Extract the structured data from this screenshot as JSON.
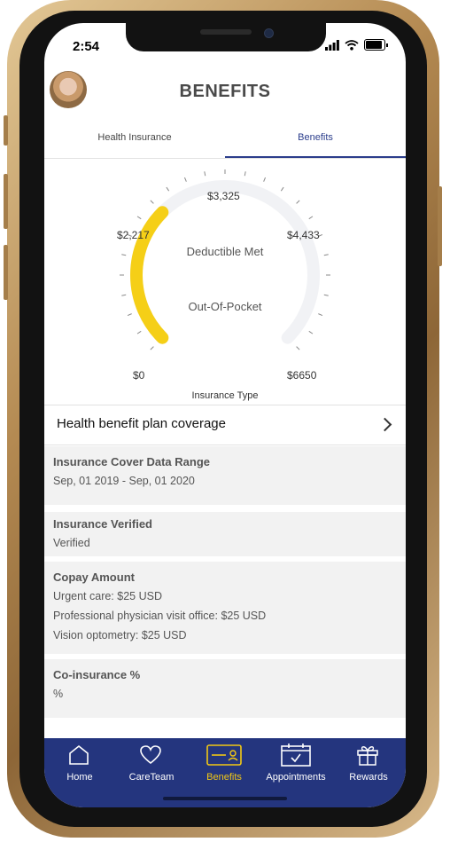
{
  "status": {
    "time": "2:54"
  },
  "header": {
    "title": "BENEFITS"
  },
  "tabs": [
    {
      "label": "Health Insurance",
      "active": false
    },
    {
      "label": "Benefits",
      "active": true
    }
  ],
  "gauge": {
    "tick_labels": [
      "$0",
      "$2,217",
      "$3,325",
      "$4,433",
      "$6650"
    ],
    "min": 0,
    "max": 6650,
    "deductible_met_value": 2217,
    "deductible_label": "Deductible Met",
    "out_of_pocket_label": "Out-Of-Pocket",
    "colors": {
      "filled": "#f5cf17",
      "track": "#f1f2f5"
    }
  },
  "insurance_type_label": "Insurance Type",
  "plan_row": {
    "label": "Health benefit plan coverage"
  },
  "cards": {
    "cover_range": {
      "title": "Insurance Cover Data Range",
      "value": "Sep, 01 2019 - Sep, 01 2020"
    },
    "verified": {
      "title": "Insurance Verified",
      "value": "Verified"
    },
    "copay": {
      "title": "Copay Amount",
      "lines": [
        "Urgent care: $25 USD",
        "Professional physician visit office: $25 USD",
        "Vision optometry: $25 USD"
      ]
    },
    "coinsurance": {
      "title": "Co-insurance %",
      "value": "%"
    }
  },
  "nav": {
    "items": [
      {
        "label": "Home",
        "icon": "home-icon"
      },
      {
        "label": "CareTeam",
        "icon": "heart-icon"
      },
      {
        "label": "Benefits",
        "icon": "card-icon",
        "active": true
      },
      {
        "label": "Appointments",
        "icon": "calendar-icon"
      },
      {
        "label": "Rewards",
        "icon": "gift-icon"
      }
    ],
    "colors": {
      "background": "#24357e",
      "active": "#f2c814"
    }
  }
}
